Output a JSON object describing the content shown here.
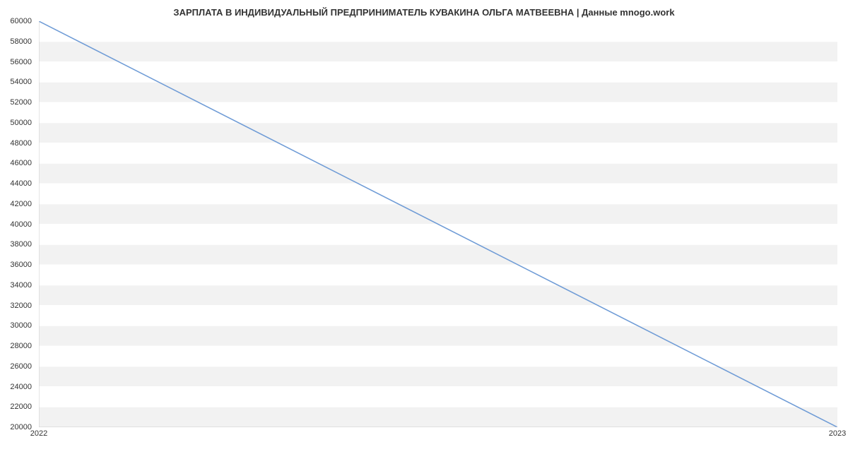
{
  "chart_data": {
    "type": "line",
    "title": "ЗАРПЛАТА В ИНДИВИДУАЛЬНЫЙ ПРЕДПРИНИМАТЕЛЬ КУВАКИНА ОЛЬГА МАТВЕЕВНА | Данные mnogo.work",
    "x": [
      2022,
      2023
    ],
    "values": [
      60000,
      20000
    ],
    "xlabel": "",
    "ylabel": "",
    "ylim": [
      20000,
      60000
    ],
    "xlim": [
      2022,
      2023
    ],
    "y_ticks": [
      20000,
      22000,
      24000,
      26000,
      28000,
      30000,
      32000,
      34000,
      36000,
      38000,
      40000,
      42000,
      44000,
      46000,
      48000,
      50000,
      52000,
      54000,
      56000,
      58000,
      60000
    ],
    "x_ticks": [
      2022,
      2023
    ],
    "line_color": "#6e9bd6",
    "grid_band_color": "#f2f2f2"
  }
}
